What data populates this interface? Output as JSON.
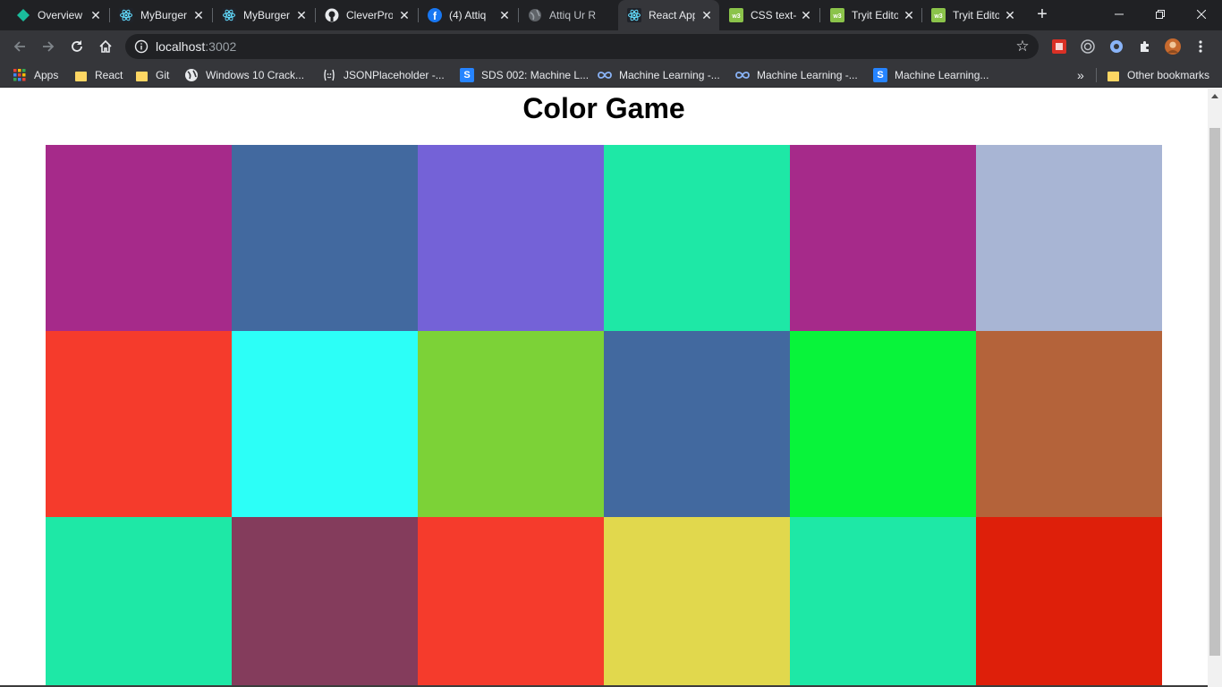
{
  "window": {
    "title": "React App"
  },
  "tabs": [
    {
      "title": "Overview",
      "icon": "teal-diamond-icon",
      "active": false
    },
    {
      "title": "MyBurger",
      "icon": "react-icon",
      "active": false
    },
    {
      "title": "MyBurger",
      "icon": "react-icon",
      "active": false
    },
    {
      "title": "CleverPro",
      "icon": "github-icon",
      "active": false
    },
    {
      "title": "(4) Attiq",
      "icon": "facebook-icon",
      "active": false
    },
    {
      "title": "Attiq Ur R",
      "icon": "globe-icon",
      "active": false
    },
    {
      "title": "React App",
      "icon": "react-icon",
      "active": true
    },
    {
      "title": "CSS text-",
      "icon": "w3schools-icon",
      "active": false
    },
    {
      "title": "Tryit Edito",
      "icon": "w3schools-icon",
      "active": false
    },
    {
      "title": "Tryit Edito",
      "icon": "w3schools-icon",
      "active": false
    }
  ],
  "toolbar": {
    "url_host": "localhost",
    "url_port": ":3002"
  },
  "bookmarks": [
    {
      "label": "Apps",
      "icon": "apps-grid-icon"
    },
    {
      "label": "React",
      "icon": "folder-icon"
    },
    {
      "label": "Git",
      "icon": "folder-icon"
    },
    {
      "label": "Windows 10 Crack...",
      "icon": "globe-icon"
    },
    {
      "label": "JSONPlaceholder -...",
      "icon": "placeholder-face-icon"
    },
    {
      "label": "SDS 002: Machine L...",
      "icon": "s-badge-icon"
    },
    {
      "label": "Machine Learning -...",
      "icon": "infinity-icon"
    },
    {
      "label": "Machine Learning -...",
      "icon": "infinity-icon"
    },
    {
      "label": "Machine Learning...",
      "icon": "s-badge-icon"
    }
  ],
  "bookmarks_overflow": "»",
  "other_bookmarks": "Other bookmarks",
  "page": {
    "title": "Color Game",
    "squares": [
      "#A62A8A",
      "#42699F",
      "#7462D7",
      "#1EE8A6",
      "#A62A8A",
      "#A8B5D4",
      "#F53B2C",
      "#2CFFF7",
      "#7CD237",
      "#42699F",
      "#08F43A",
      "#B4633A",
      "#1EE8A6",
      "#843C5C",
      "#F53B2C",
      "#E1D84D",
      "#1EE8A6",
      "#DE1F0A"
    ]
  },
  "colors": {
    "chrome_dark": "#202124",
    "chrome_toolbar": "#35363a",
    "text_light": "#e8eaed"
  }
}
